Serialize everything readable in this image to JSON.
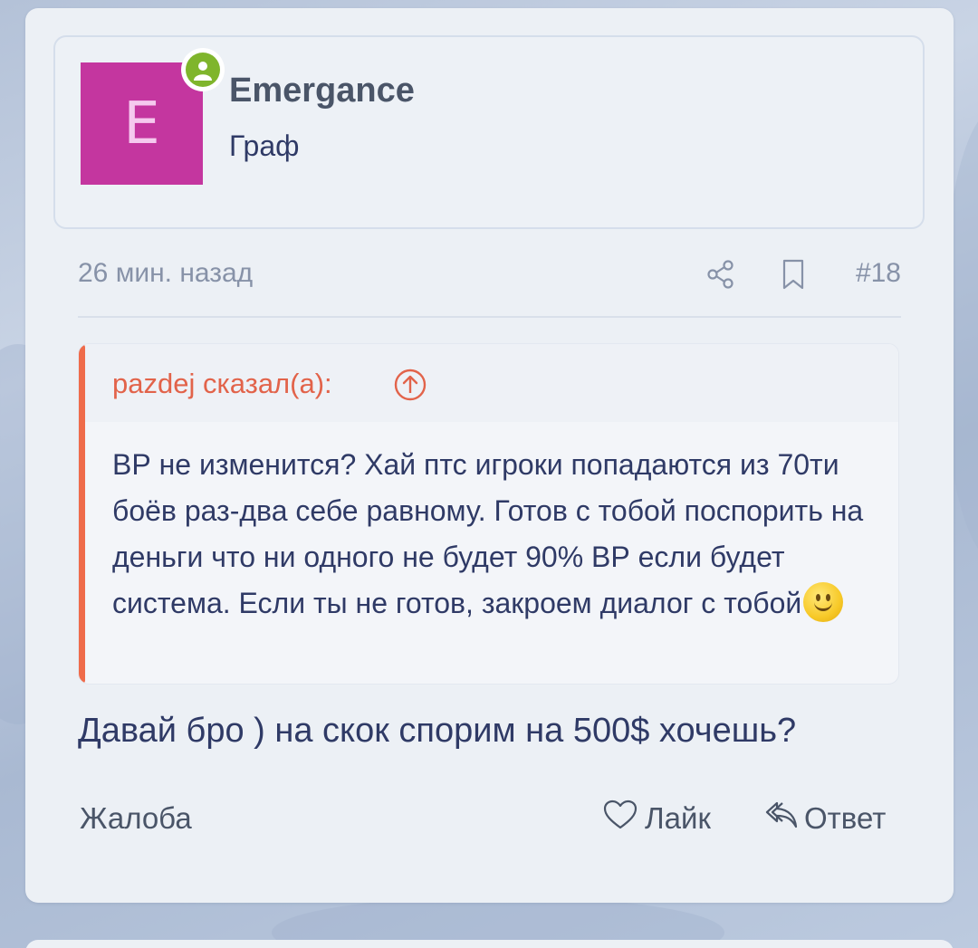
{
  "post": {
    "username": "Emergance",
    "avatar_letter": "E",
    "user_title": "Граф",
    "time": "26 мин. назад",
    "post_number": "#18",
    "quote": {
      "author": "pazdej сказал(а):",
      "text": "ВР не изменится? Хай птс игроки попадаются из 70ти боёв раз-два себе равному. Готов с тобой поспорить на деньги что ни одного не будет 90% ВР если будет система. Если ты не готов, закроем диалог с тобой"
    },
    "message": "Давай бро ) на скок спорим на 500$ хочешь?",
    "actions": {
      "complaint": "Жалоба",
      "like": "Лайк",
      "reply": "Ответ"
    }
  },
  "colors": {
    "avatar_bg": "#c4369f",
    "online": "#7fb52c",
    "quote_accent": "#ef6b4a",
    "text": "#2f3a66",
    "muted": "#8792a8"
  },
  "icons": [
    "online-user-icon",
    "share-icon",
    "bookmark-icon",
    "arrow-up-circle-icon",
    "smile-emoji",
    "heart-icon",
    "reply-icon"
  ]
}
